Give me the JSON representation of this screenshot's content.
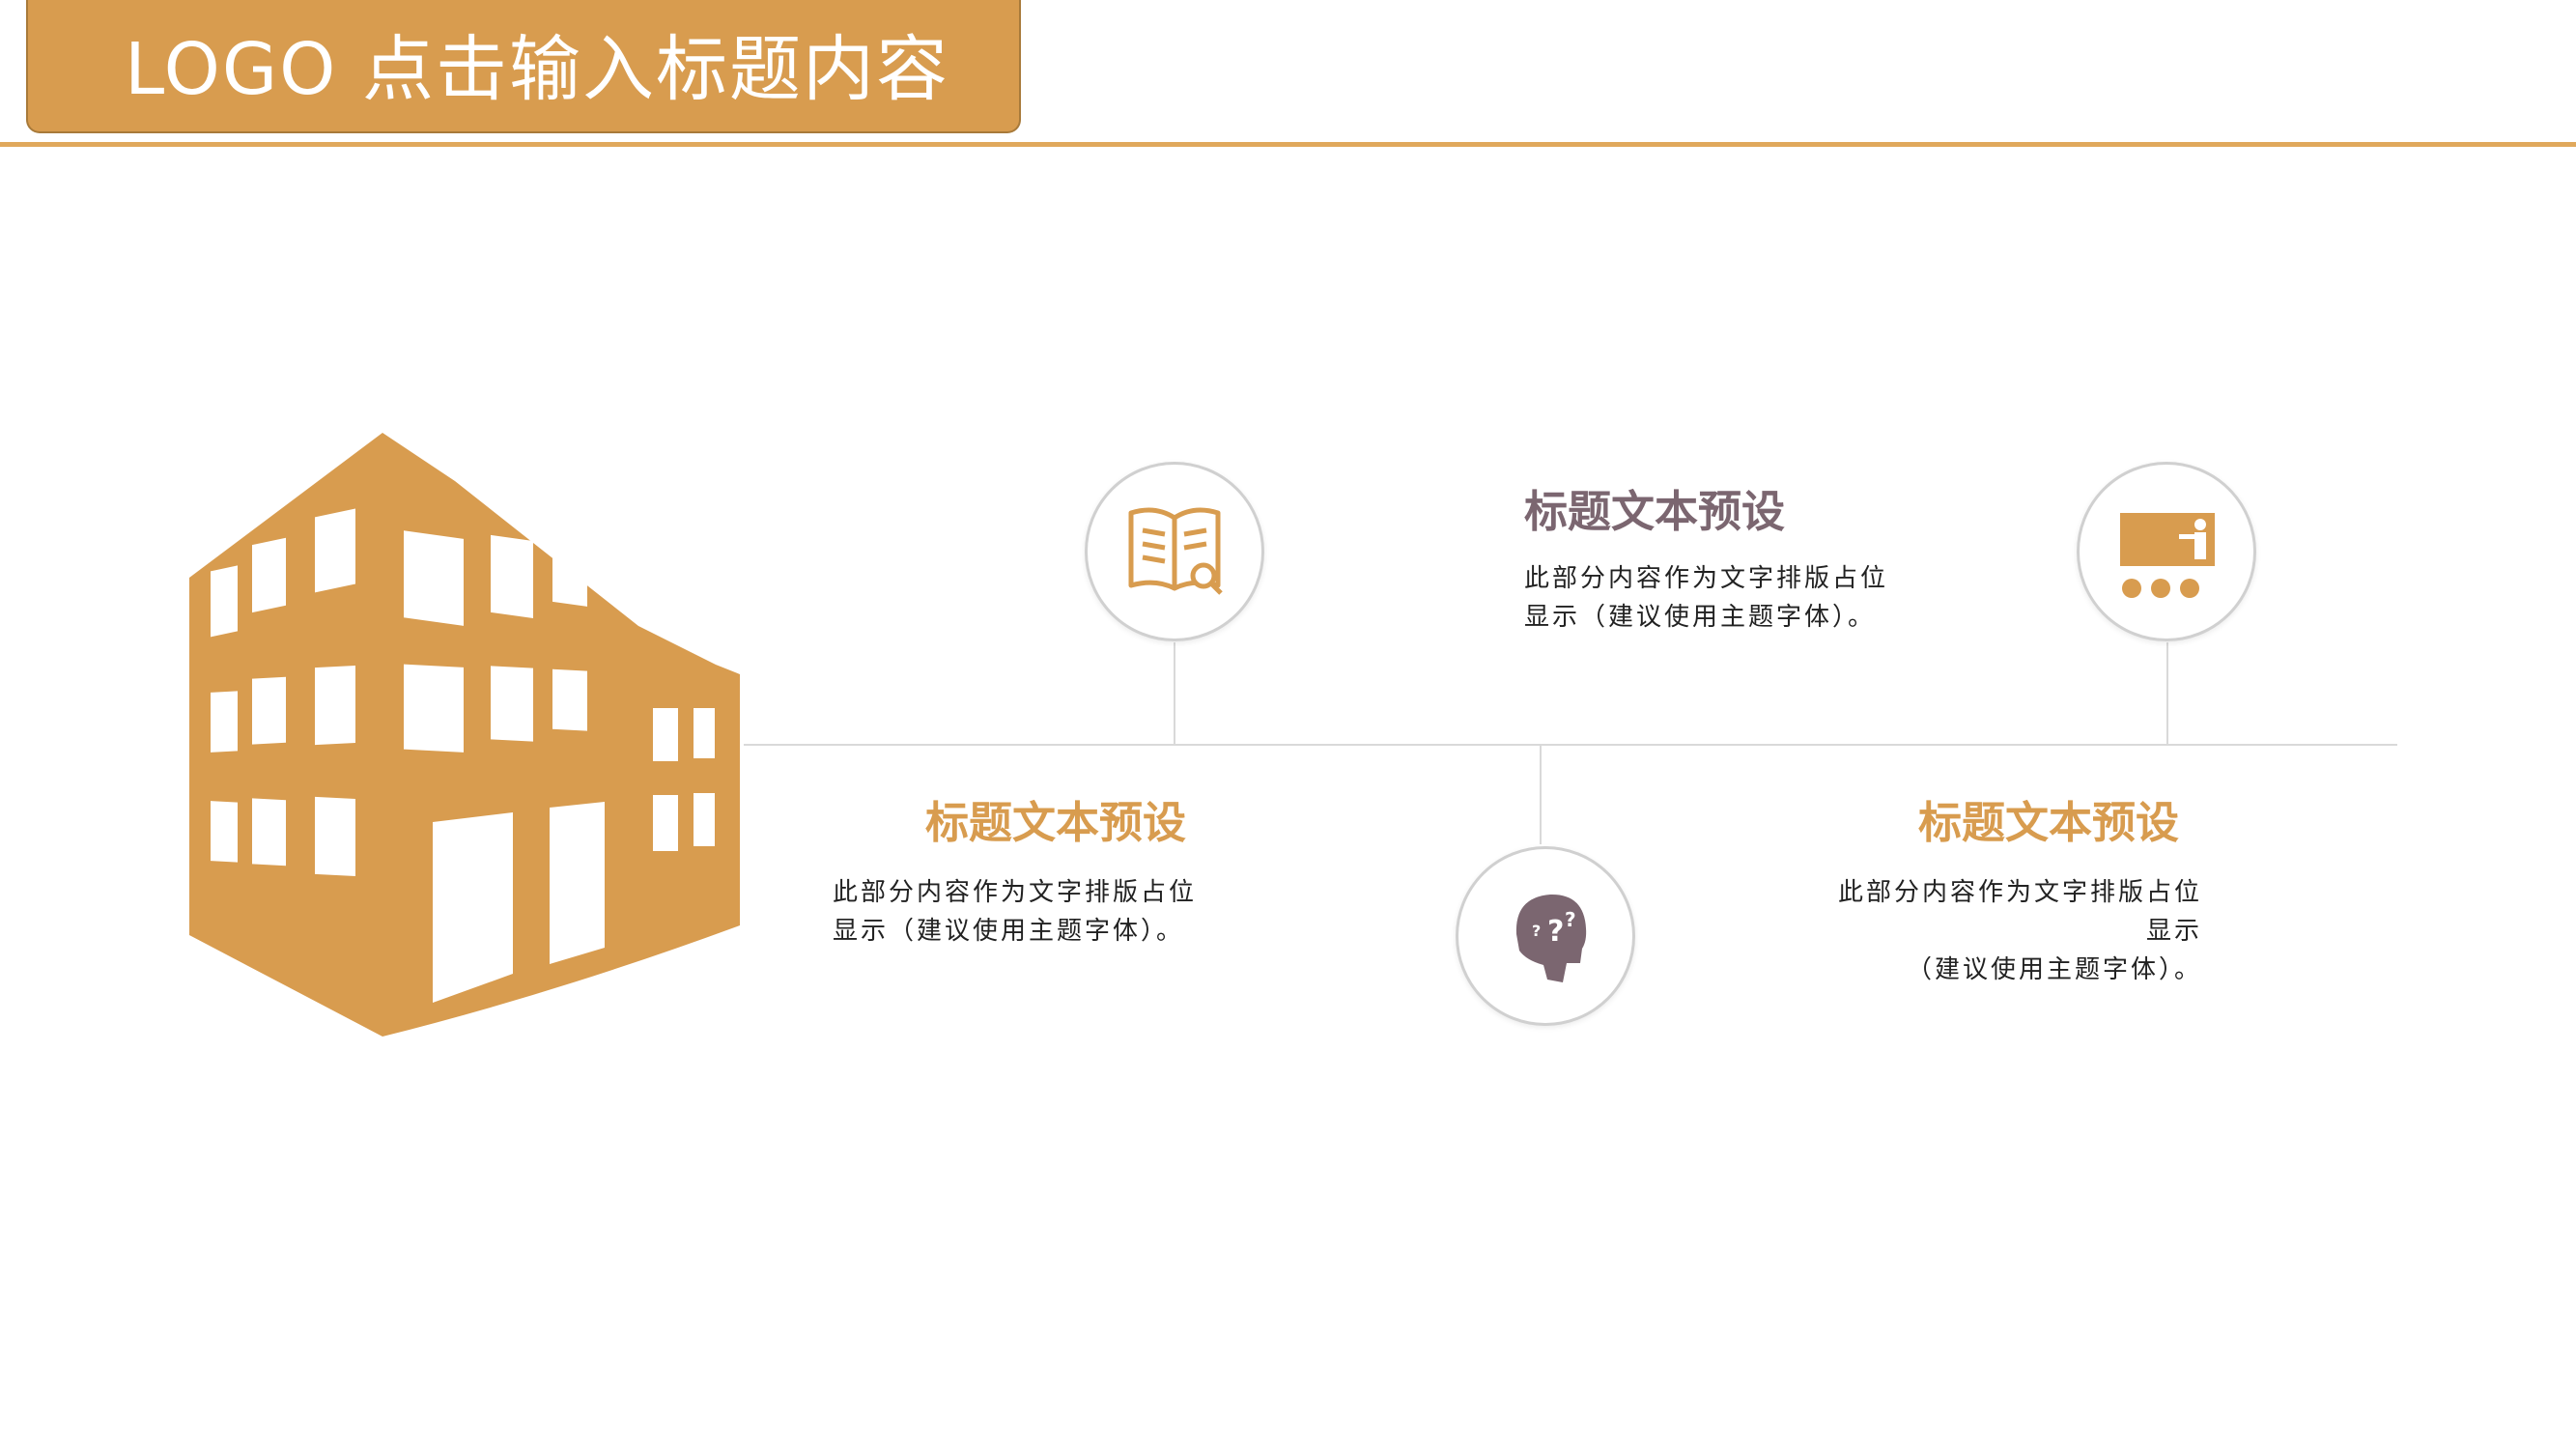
{
  "header": {
    "title": "LOGO  点击输入标题内容"
  },
  "colors": {
    "accent": "#d89c4f",
    "mauve": "#7b6670",
    "line": "#d9d9d9"
  },
  "items": [
    {
      "title": "标题文本预设",
      "body": "此部分内容作为文字排版占位\n显示（建议使用主题字体）。",
      "icon": "book-magnifier-icon"
    },
    {
      "title": "标题文本预设",
      "body": "此部分内容作为文字排版占位\n显示（建议使用主题字体）。",
      "icon": "thinking-head-icon"
    },
    {
      "title": "标题文本预设",
      "body": "此部分内容作为文字排版占位\n显示（建议使用主题字体）。",
      "icon": "presentation-board-icon"
    },
    {
      "title": "标题文本预设",
      "body": "此部分内容作为文字排版占位显示\n（建议使用主题字体）。",
      "icon": "thinking-head-icon"
    }
  ]
}
